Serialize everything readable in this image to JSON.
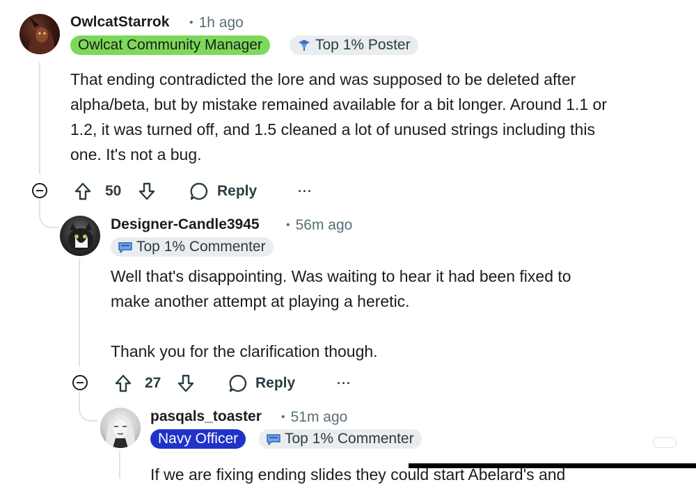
{
  "comments": [
    {
      "username": "OwlcatStarrok",
      "time": "1h ago",
      "flair": "Owlcat Community Manager",
      "achievement": "Top 1% Poster",
      "body": "That ending contradicted the lore and was supposed to be deleted after\nalpha/beta, but by mistake remained available for a bit longer. Around 1.1 or\n1.2, it was turned off, and 1.5 cleaned a lot of unused strings including this\none. It's not a bug.",
      "votes": "50",
      "reply_label": "Reply",
      "more_label": "···"
    },
    {
      "username": "Designer-Candle3945",
      "time": "56m ago",
      "achievement": "Top 1% Commenter",
      "body": "Well that's disappointing. Was waiting to hear it had been fixed to\nmake another attempt at playing a heretic.\n\nThank you for the clarification though.",
      "votes": "27",
      "reply_label": "Reply",
      "more_label": "···"
    },
    {
      "username": "pasqals_toaster",
      "time": "51m ago",
      "flair": "Navy Officer",
      "achievement": "Top 1% Commenter",
      "body": "If we are fixing ending slides they could start Abelard's and"
    }
  ],
  "meta_separator": "•",
  "icons": {
    "upvote": "arrow-up-icon",
    "downvote": "arrow-down-icon",
    "reply": "speech-bubble-icon",
    "collapse": "minus-circle-icon"
  },
  "colors": {
    "community_manager_flair": "#7dd95a",
    "navy_flair": "#1f33c9",
    "achievement_badge": "#eaedef",
    "meta_text": "#576f76"
  }
}
